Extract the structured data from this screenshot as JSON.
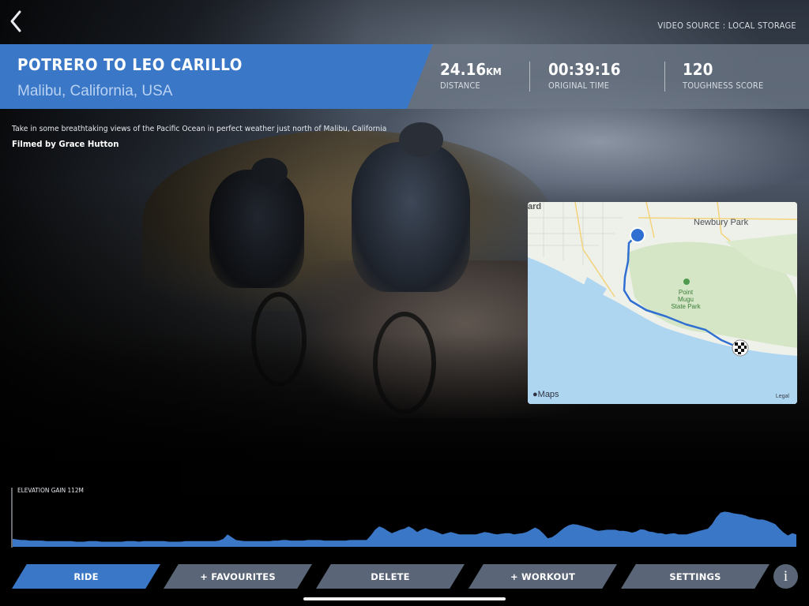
{
  "header": {
    "video_source": "VIDEO SOURCE : LOCAL STORAGE"
  },
  "route": {
    "title": "POTRERO TO LEO CARILLO",
    "location": "Malibu, California, USA",
    "description": "Take in some breathtaking views of the Pacific Ocean in perfect weather just north of Malibu, California",
    "credit": "Filmed by Grace Hutton"
  },
  "stats": [
    {
      "value": "24.16",
      "unit": "KM",
      "label": "DISTANCE"
    },
    {
      "value": "00:39:16",
      "unit": "",
      "label": "ORIGINAL TIME"
    },
    {
      "value": "120",
      "unit": "",
      "label": "TOUGHNESS SCORE"
    }
  ],
  "map": {
    "place_label": "Newbury Park",
    "edge_label": "ard",
    "park_label": "Point Mugu State Park",
    "brand": "Maps",
    "legal": "Legal",
    "route_color": "#2f6fd1",
    "water_color": "#aed6f1",
    "land_color": "#d5e6c6"
  },
  "elevation": {
    "label": "ELEVATION GAIN 112M",
    "fill_color": "#3a77c7",
    "profile": [
      0.14,
      0.13,
      0.12,
      0.12,
      0.11,
      0.11,
      0.11,
      0.11,
      0.1,
      0.1,
      0.1,
      0.1,
      0.1,
      0.1,
      0.1,
      0.09,
      0.09,
      0.09,
      0.1,
      0.1,
      0.1,
      0.09,
      0.09,
      0.09,
      0.09,
      0.09,
      0.09,
      0.1,
      0.1,
      0.1,
      0.09,
      0.1,
      0.1,
      0.1,
      0.1,
      0.1,
      0.1,
      0.09,
      0.09,
      0.09,
      0.09,
      0.1,
      0.1,
      0.1,
      0.1,
      0.1,
      0.1,
      0.1,
      0.1,
      0.11,
      0.14,
      0.22,
      0.17,
      0.12,
      0.11,
      0.1,
      0.1,
      0.1,
      0.1,
      0.1,
      0.1,
      0.1,
      0.11,
      0.11,
      0.12,
      0.12,
      0.11,
      0.11,
      0.11,
      0.11,
      0.12,
      0.12,
      0.12,
      0.12,
      0.11,
      0.11,
      0.11,
      0.11,
      0.11,
      0.11,
      0.12,
      0.12,
      0.12,
      0.12,
      0.12,
      0.2,
      0.3,
      0.36,
      0.33,
      0.28,
      0.24,
      0.27,
      0.3,
      0.32,
      0.36,
      0.32,
      0.26,
      0.3,
      0.33,
      0.3,
      0.28,
      0.25,
      0.22,
      0.24,
      0.26,
      0.24,
      0.22,
      0.22,
      0.22,
      0.22,
      0.22,
      0.24,
      0.26,
      0.25,
      0.23,
      0.22,
      0.23,
      0.24,
      0.24,
      0.22,
      0.23,
      0.24,
      0.26,
      0.3,
      0.34,
      0.3,
      0.23,
      0.15,
      0.17,
      0.22,
      0.28,
      0.34,
      0.38,
      0.4,
      0.39,
      0.37,
      0.35,
      0.33,
      0.3,
      0.28,
      0.29,
      0.3,
      0.3,
      0.3,
      0.28,
      0.28,
      0.27,
      0.25,
      0.27,
      0.31,
      0.3,
      0.27,
      0.26,
      0.24,
      0.24,
      0.22,
      0.23,
      0.24,
      0.22,
      0.22,
      0.22,
      0.24,
      0.26,
      0.28,
      0.3,
      0.32,
      0.4,
      0.52,
      0.6,
      0.62,
      0.61,
      0.59,
      0.58,
      0.57,
      0.55,
      0.52,
      0.5,
      0.48,
      0.48,
      0.46,
      0.43,
      0.4,
      0.32,
      0.25,
      0.2,
      0.24,
      0.22
    ]
  },
  "actions": {
    "ride": "RIDE",
    "favourites": "+ FAVOURITES",
    "delete": "DELETE",
    "workout": "+ WORKOUT",
    "settings": "SETTINGS",
    "info": "i"
  }
}
